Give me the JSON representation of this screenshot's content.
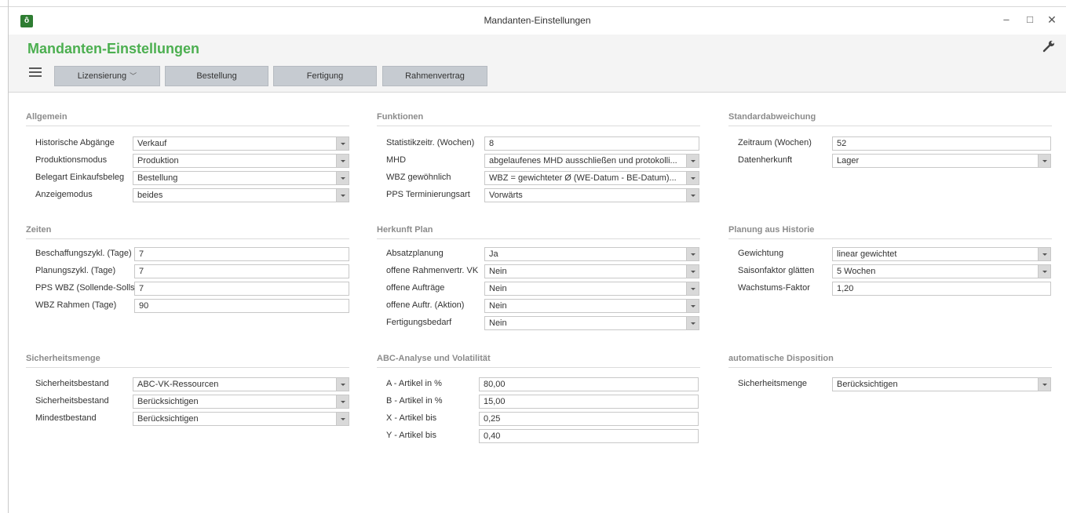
{
  "window": {
    "title": "Mandanten-Einstellungen",
    "controls": {
      "minimize": "–",
      "maximize": "□",
      "close": "✕"
    }
  },
  "header": {
    "title": "Mandanten-Einstellungen",
    "menu_icon": "hamburger-icon",
    "settings_icon": "wrench-icon",
    "tabs": [
      {
        "label": "Lizensierung",
        "has_dropdown": true
      },
      {
        "label": "Bestellung"
      },
      {
        "label": "Fertigung"
      },
      {
        "label": "Rahmenvertrag"
      }
    ]
  },
  "colors": {
    "title_green": "#4caf50",
    "tab_bg": "#c6cbd1",
    "section_title": "#8c8c8c"
  },
  "sections": {
    "allgemein": {
      "title": "Allgemein",
      "rows": [
        {
          "label": "Historische Abgänge",
          "value": "Verkauf"
        },
        {
          "label": "Produktionsmodus",
          "value": "Produktion"
        },
        {
          "label": "Belegart Einkaufsbeleg",
          "value": "Bestellung"
        },
        {
          "label": "Anzeigemodus",
          "value": "beides"
        }
      ]
    },
    "funktionen": {
      "title": "Funktionen",
      "rows": [
        {
          "label": "Statistikzeitr. (Wochen)",
          "value": "8"
        },
        {
          "label": "MHD",
          "value": "abgelaufenes MHD ausschließen und protokolli..."
        },
        {
          "label": "WBZ gewöhnlich",
          "value": "WBZ = gewichteter Ø (WE-Datum - BE-Datum)..."
        },
        {
          "label": "PPS Terminierungsart",
          "value": "Vorwärts"
        }
      ]
    },
    "standardabweichung": {
      "title": "Standardabweichung",
      "rows": [
        {
          "label": "Zeitraum (Wochen)",
          "value": "52"
        },
        {
          "label": "Datenherkunft",
          "value": "Lager"
        }
      ]
    },
    "zeiten": {
      "title": "Zeiten",
      "rows": [
        {
          "label": "Beschaffungszykl. (Tage)",
          "value": "7"
        },
        {
          "label": "Planungszykl. (Tage)",
          "value": "7"
        },
        {
          "label": "PPS WBZ (Sollende-Solls",
          "value": "7"
        },
        {
          "label": "WBZ Rahmen (Tage)",
          "value": "90"
        }
      ]
    },
    "herkunft_plan": {
      "title": "Herkunft Plan",
      "rows": [
        {
          "label": "Absatzplanung",
          "value": "Ja"
        },
        {
          "label": "offene Rahmenvertr. VK",
          "value": "Nein"
        },
        {
          "label": "offene Aufträge",
          "value": "Nein"
        },
        {
          "label": "offene Auftr. (Aktion)",
          "value": "Nein"
        },
        {
          "label": "Fertigungsbedarf",
          "value": "Nein"
        }
      ]
    },
    "planung_historie": {
      "title": "Planung aus Historie",
      "rows": [
        {
          "label": "Gewichtung",
          "value": "linear gewichtet"
        },
        {
          "label": "Saisonfaktor glätten",
          "value": "5 Wochen"
        },
        {
          "label": "Wachstums-Faktor",
          "value": "1,20"
        }
      ]
    },
    "sicherheitsmenge": {
      "title": "Sicherheitsmenge",
      "rows": [
        {
          "label": "Sicherheitsbestand",
          "value": "ABC-VK-Ressourcen"
        },
        {
          "label": "Sicherheitsbestand",
          "value": "Berücksichtigen"
        },
        {
          "label": "Mindestbestand",
          "value": "Berücksichtigen"
        }
      ]
    },
    "abc_analyse": {
      "title": "ABC-Analyse und Volatilität",
      "rows": [
        {
          "label": "A - Artikel in %",
          "value": "80,00"
        },
        {
          "label": "B - Artikel in %",
          "value": "15,00"
        },
        {
          "label": "X - Artikel bis",
          "value": "0,25"
        },
        {
          "label": "Y - Artikel bis",
          "value": "0,40"
        }
      ]
    },
    "auto_disposition": {
      "title": "automatische Disposition",
      "rows": [
        {
          "label": "Sicherheitsmenge",
          "value": "Berücksichtigen"
        }
      ]
    }
  }
}
